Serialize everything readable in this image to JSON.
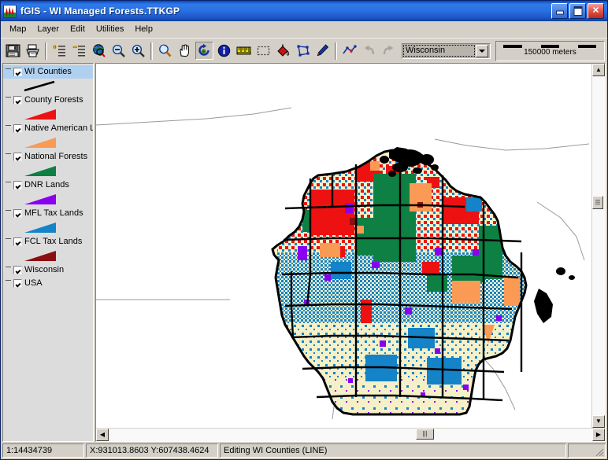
{
  "window": {
    "title": "fGIS - WI Managed Forests.TTKGP",
    "icon": "fgis-app-icon",
    "buttons": [
      {
        "name": "minimize-button",
        "label": "Minimize",
        "glyph": "minimize-icon"
      },
      {
        "name": "maximize-button",
        "label": "Maximize",
        "glyph": "maximize-icon"
      },
      {
        "name": "close-button",
        "label": "Close",
        "glyph": "close-icon"
      }
    ]
  },
  "menu": {
    "items": [
      {
        "label": "Map"
      },
      {
        "label": "Layer"
      },
      {
        "label": "Edit"
      },
      {
        "label": "Utilities"
      },
      {
        "label": "Help"
      }
    ]
  },
  "toolbar": {
    "buttons": [
      {
        "name": "save-button",
        "icon": "floppy-disk-icon",
        "tooltip": "Save",
        "state": "enabled"
      },
      {
        "name": "print-button",
        "icon": "printer-icon",
        "tooltip": "Print",
        "state": "enabled"
      },
      {
        "name": "add-layer-button",
        "icon": "add-layer-icon",
        "tooltip": "Add Layer",
        "state": "enabled"
      },
      {
        "name": "remove-layer-button",
        "icon": "remove-layer-icon",
        "tooltip": "Remove Layer",
        "state": "enabled"
      },
      {
        "name": "zoom-full-button",
        "icon": "globe-zoom-icon",
        "tooltip": "Zoom Full Extent",
        "state": "enabled"
      },
      {
        "name": "zoom-out-button",
        "icon": "zoom-out-icon",
        "tooltip": "Zoom Out",
        "state": "enabled"
      },
      {
        "name": "zoom-in-button",
        "icon": "zoom-in-icon",
        "tooltip": "Zoom In",
        "state": "enabled"
      },
      {
        "name": "zoom-window-button",
        "icon": "magnifier-icon",
        "tooltip": "Zoom Window",
        "state": "enabled"
      },
      {
        "name": "pan-button",
        "icon": "pan-hand-icon",
        "tooltip": "Pan",
        "state": "enabled"
      },
      {
        "name": "refresh-button",
        "icon": "refresh-arrow-icon",
        "tooltip": "Redraw",
        "state": "pressed"
      },
      {
        "name": "identify-button",
        "icon": "info-circle-icon",
        "tooltip": "Identify",
        "state": "enabled"
      },
      {
        "name": "measure-button",
        "icon": "ruler-icon",
        "tooltip": "Measure",
        "state": "enabled"
      },
      {
        "name": "select-box-button",
        "icon": "marquee-select-icon",
        "tooltip": "Select",
        "state": "enabled"
      },
      {
        "name": "fill-button",
        "icon": "paint-bucket-icon",
        "tooltip": "Fill",
        "state": "enabled"
      },
      {
        "name": "node-edit-button",
        "icon": "polygon-node-icon",
        "tooltip": "Edit Nodes",
        "state": "enabled"
      },
      {
        "name": "draw-button",
        "icon": "pencil-icon",
        "tooltip": "Draw",
        "state": "enabled"
      },
      {
        "name": "edit-line-button",
        "icon": "edit-line-icon",
        "tooltip": "Edit Line",
        "state": "enabled"
      },
      {
        "name": "undo-button",
        "icon": "undo-arrow-icon",
        "tooltip": "Undo",
        "state": "disabled"
      },
      {
        "name": "redo-button",
        "icon": "redo-arrow-icon",
        "tooltip": "Redo",
        "state": "disabled"
      }
    ],
    "project_combo": {
      "value": "Wisconsin",
      "options": [
        "Wisconsin"
      ]
    },
    "scalebar": {
      "label": "150000 meters"
    }
  },
  "layers": {
    "items": [
      {
        "label": "WI Counties",
        "checked": true,
        "selected": true,
        "symbol": "line",
        "color": "#000000"
      },
      {
        "label": "County Forests",
        "checked": true,
        "selected": false,
        "symbol": "polygon",
        "color": "#ee1111"
      },
      {
        "label": "Native American L",
        "checked": true,
        "selected": false,
        "symbol": "polygon",
        "color": "#fa9a55"
      },
      {
        "label": "National Forests",
        "checked": true,
        "selected": false,
        "symbol": "polygon",
        "color": "#0e8043"
      },
      {
        "label": "DNR Lands",
        "checked": true,
        "selected": false,
        "symbol": "polygon",
        "color": "#8800ee"
      },
      {
        "label": "MFL Tax Lands",
        "checked": true,
        "selected": false,
        "symbol": "polygon",
        "color": "#1483c8"
      },
      {
        "label": "FCL Tax Lands",
        "checked": true,
        "selected": false,
        "symbol": "polygon",
        "color": "#8b0f10"
      },
      {
        "label": "Wisconsin",
        "checked": true,
        "selected": false,
        "symbol": "none",
        "color": "#000000"
      },
      {
        "label": "USA",
        "checked": true,
        "selected": false,
        "symbol": "none",
        "color": "#000000"
      }
    ]
  },
  "map": {
    "background": "#ffffff",
    "land_fill": "#f5f0c8",
    "outline": "#000000",
    "scrollbars": {
      "vertical": {
        "up_arrow": "▲",
        "down_arrow": "▼",
        "thumb_position_pct": 38
      },
      "horizontal": {
        "left_arrow": "◀",
        "right_arrow": "▶",
        "thumb_position_pct": 65
      }
    }
  },
  "statusbar": {
    "scale": "1:14434739",
    "coordinates": "X:931013.8603 Y:607438.4624",
    "mode": "Editing WI Counties (LINE)",
    "extra": ""
  }
}
